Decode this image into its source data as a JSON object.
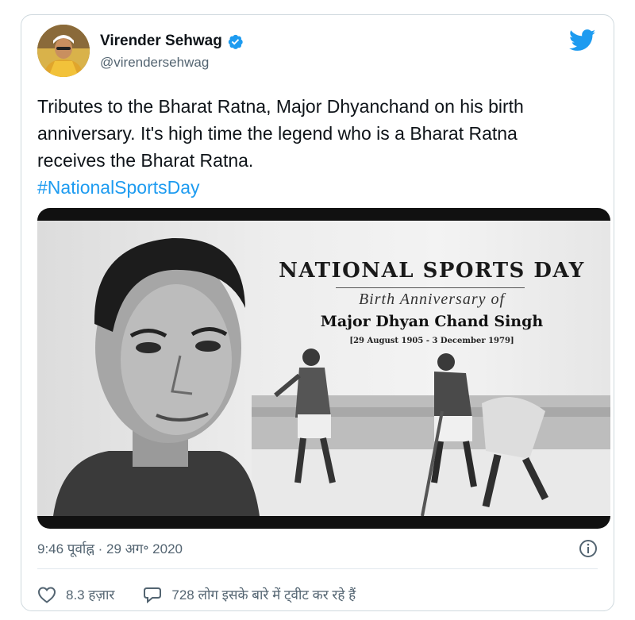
{
  "author": {
    "name": "Virender Sehwag",
    "handle": "@virendersehwag"
  },
  "tweet": {
    "lines": [
      "Tributes to the Bharat Ratna, Major Dhyanchand on his birth",
      "anniversary. It's high time the legend who is a Bharat Ratna",
      "receives the Bharat Ratna."
    ],
    "hashtag": "#NationalSportsDay"
  },
  "media": {
    "title": "NATIONAL SPORTS DAY",
    "subtitle": "Birth Anniversary of",
    "person": "Major Dhyan Chand Singh",
    "dates": "[29 August 1905 - 3 December 1979]"
  },
  "meta": {
    "timestamp": "9:46 पूर्वाह्न · 29 अग॰ 2020"
  },
  "actions": {
    "likes": "8.3 हज़ार",
    "replies_text": "728 लोग इसके बारे में ट्वीट कर रहे हैं"
  },
  "icons": {
    "verified": "verified-badge-icon",
    "twitter": "twitter-bird-icon",
    "info": "info-icon",
    "like": "heart-icon",
    "reply": "speech-bubble-icon"
  },
  "colors": {
    "link": "#1d9bf0",
    "secondary_text": "#536471",
    "border": "#cfd9de"
  }
}
